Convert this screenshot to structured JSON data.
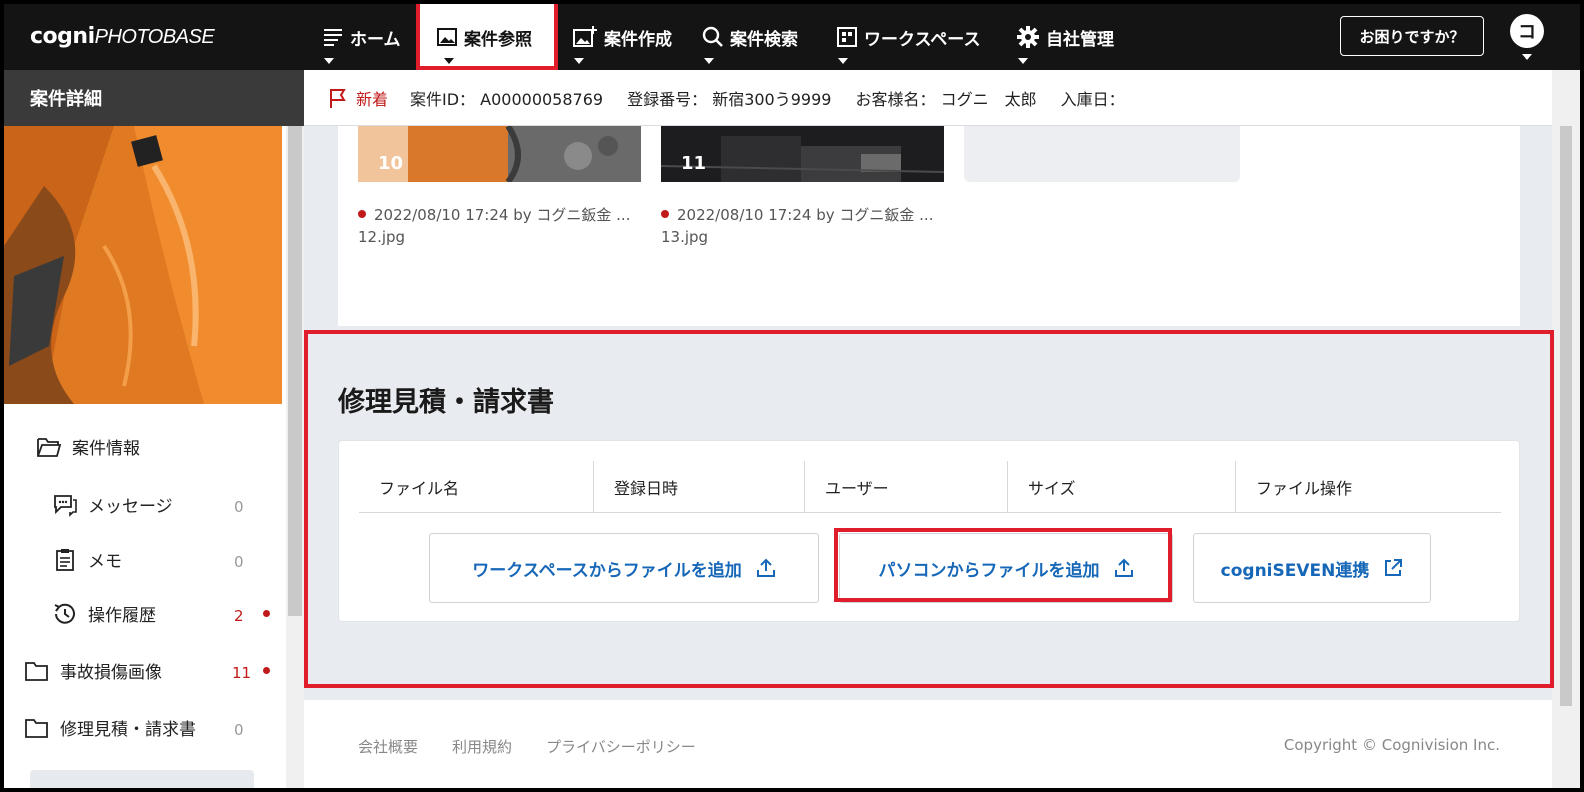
{
  "app": {
    "logo_text_1": "cogni",
    "logo_text_2": "PHOTOBASE"
  },
  "nav": {
    "items": [
      {
        "label": "ホーム",
        "icon": "list-icon"
      },
      {
        "label": "案件参照",
        "icon": "image-icon"
      },
      {
        "label": "案件作成",
        "icon": "add-image-icon"
      },
      {
        "label": "案件検索",
        "icon": "search-icon"
      },
      {
        "label": "ワークスペース",
        "icon": "workspace-icon"
      },
      {
        "label": "自社管理",
        "icon": "gear-icon"
      }
    ],
    "help_button": "お困りですか？",
    "avatar_initial": "コ"
  },
  "sidebar": {
    "title": "案件詳細",
    "items": [
      {
        "label": "案件情報",
        "icon": "folder-open-icon",
        "count": ""
      },
      {
        "label": "メッセージ",
        "icon": "chat-icon",
        "count": "0"
      },
      {
        "label": "メモ",
        "icon": "clipboard-icon",
        "count": "0"
      },
      {
        "label": "操作履歴",
        "icon": "history-icon",
        "count": "2",
        "dot": true
      },
      {
        "label": "事故損傷画像",
        "icon": "folder-icon",
        "count": "11",
        "dot": true
      },
      {
        "label": "修理見積・請求書",
        "icon": "folder-icon",
        "count": "0"
      }
    ]
  },
  "info_bar": {
    "status": "新着",
    "case_id_label": "案件ID：",
    "case_id": "A00000058769",
    "reg_label": "登録番号：",
    "reg_value": "新宿300う9999",
    "customer_label": "お客様名：",
    "customer_value": "コグニ　太郎",
    "entry_label": "入庫日："
  },
  "images": [
    {
      "number": "10",
      "meta": "2022/08/10 17:24 by コグニ鈑金 ...",
      "filename": "12.jpg"
    },
    {
      "number": "11",
      "meta": "2022/08/10 17:24 by コグニ鈑金 ...",
      "filename": "13.jpg"
    }
  ],
  "estimate": {
    "title": "修理見積・請求書",
    "columns": [
      "ファイル名",
      "登録日時",
      "ユーザー",
      "サイズ",
      "ファイル操作"
    ],
    "buttons": {
      "workspace": "ワークスペースからファイルを追加",
      "pc": "パソコンからファイルを追加",
      "seven": "cogniSEVEN連携"
    }
  },
  "footer": {
    "links": [
      "会社概要",
      "利用規約",
      "プライバシーポリシー"
    ],
    "copyright": "Copyright © Cognivision Inc."
  },
  "colors": {
    "accent_blue": "#1667b7",
    "highlight_red": "#e01e2b",
    "status_red": "#c01a1a",
    "nav_bg": "#141414"
  }
}
